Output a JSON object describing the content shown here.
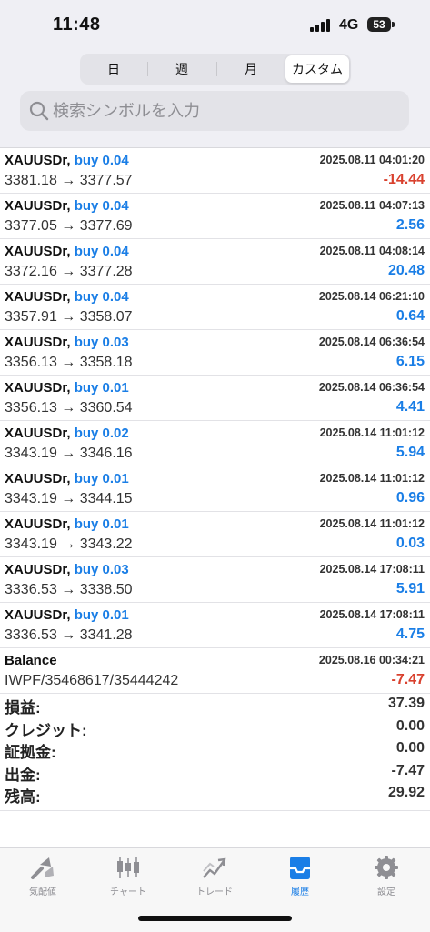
{
  "status_bar": {
    "time": "11:48",
    "network": "4G",
    "battery": "53"
  },
  "segments": [
    {
      "label": "日",
      "active": false
    },
    {
      "label": "週",
      "active": false
    },
    {
      "label": "月",
      "active": false
    },
    {
      "label": "カスタム",
      "active": true
    }
  ],
  "search": {
    "placeholder": "検索シンボルを入力",
    "value": ""
  },
  "trades": [
    {
      "symbol": "XAUUSDr,",
      "side": "buy 0.04",
      "time": "2025.08.11 04:01:20",
      "prices": "3381.18 → 3377.57",
      "profit": "-14.44",
      "negative": true
    },
    {
      "symbol": "XAUUSDr,",
      "side": "buy 0.04",
      "time": "2025.08.11 04:07:13",
      "prices": "3377.05 → 3377.69",
      "profit": "2.56",
      "negative": false
    },
    {
      "symbol": "XAUUSDr,",
      "side": "buy 0.04",
      "time": "2025.08.11 04:08:14",
      "prices": "3372.16 → 3377.28",
      "profit": "20.48",
      "negative": false
    },
    {
      "symbol": "XAUUSDr,",
      "side": "buy 0.04",
      "time": "2025.08.14 06:21:10",
      "prices": "3357.91 → 3358.07",
      "profit": "0.64",
      "negative": false
    },
    {
      "symbol": "XAUUSDr,",
      "side": "buy 0.03",
      "time": "2025.08.14 06:36:54",
      "prices": "3356.13 → 3358.18",
      "profit": "6.15",
      "negative": false
    },
    {
      "symbol": "XAUUSDr,",
      "side": "buy 0.01",
      "time": "2025.08.14 06:36:54",
      "prices": "3356.13 → 3360.54",
      "profit": "4.41",
      "negative": false
    },
    {
      "symbol": "XAUUSDr,",
      "side": "buy 0.02",
      "time": "2025.08.14 11:01:12",
      "prices": "3343.19 → 3346.16",
      "profit": "5.94",
      "negative": false
    },
    {
      "symbol": "XAUUSDr,",
      "side": "buy 0.01",
      "time": "2025.08.14 11:01:12",
      "prices": "3343.19 → 3344.15",
      "profit": "0.96",
      "negative": false
    },
    {
      "symbol": "XAUUSDr,",
      "side": "buy 0.01",
      "time": "2025.08.14 11:01:12",
      "prices": "3343.19 → 3343.22",
      "profit": "0.03",
      "negative": false
    },
    {
      "symbol": "XAUUSDr,",
      "side": "buy 0.03",
      "time": "2025.08.14 17:08:11",
      "prices": "3336.53 → 3338.50",
      "profit": "5.91",
      "negative": false
    },
    {
      "symbol": "XAUUSDr,",
      "side": "buy 0.01",
      "time": "2025.08.14 17:08:11",
      "prices": "3336.53 → 3341.28",
      "profit": "4.75",
      "negative": false
    },
    {
      "symbol": "Balance",
      "side": "",
      "time": "2025.08.16 00:34:21",
      "prices": "IWPF/35468617/35444242",
      "profit": "-7.47",
      "negative": true
    }
  ],
  "summary": [
    {
      "label": "損益:",
      "value": "37.39"
    },
    {
      "label": "クレジット:",
      "value": "0.00"
    },
    {
      "label": "証拠金:",
      "value": "0.00"
    },
    {
      "label": "出金:",
      "value": "-7.47"
    },
    {
      "label": "残高:",
      "value": "29.92"
    }
  ],
  "tabs": [
    {
      "label": "気配値",
      "icon": "quotes-icon",
      "active": false
    },
    {
      "label": "チャート",
      "icon": "chart-icon",
      "active": false
    },
    {
      "label": "トレード",
      "icon": "trade-icon",
      "active": false
    },
    {
      "label": "履歴",
      "icon": "history-icon",
      "active": true
    },
    {
      "label": "設定",
      "icon": "settings-icon",
      "active": false
    }
  ],
  "colors": {
    "accent": "#1a7ee6",
    "negative": "#d9412e",
    "inactive": "#8e8e93"
  }
}
